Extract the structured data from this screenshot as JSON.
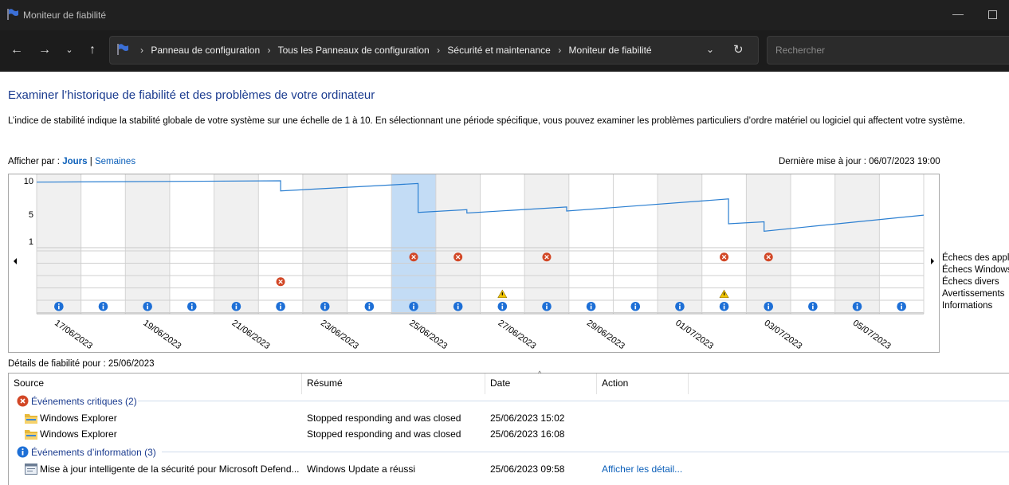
{
  "window": {
    "title": "Moniteur de fiabilité"
  },
  "address": {
    "crumbs": [
      "Panneau de configuration",
      "Tous les Panneaux de configuration",
      "Sécurité et maintenance",
      "Moniteur de fiabilité"
    ],
    "search_placeholder": "Rechercher"
  },
  "page": {
    "heading": "Examiner l’historique de fiabilité et des problèmes de votre ordinateur",
    "description": "L’indice de stabilité indique la stabilité globale de votre système sur une échelle de 1 à 10. En sélectionnant une période spécifique, vous pouvez examiner les problèmes particuliers d’ordre matériel ou logiciel qui affectent votre système.",
    "view_by_label": "Afficher par :",
    "view_days": "Jours",
    "view_sep": "|",
    "view_weeks": "Semaines",
    "last_update": "Dernière mise à jour : 06/07/2023 19:00"
  },
  "chart_data": {
    "type": "line",
    "y_ticks": [
      "10",
      "5",
      "1"
    ],
    "ylim": [
      1,
      10
    ],
    "columns": 20,
    "selected_column": 8,
    "weekend_columns": [
      0,
      2,
      4,
      6,
      9,
      11,
      14,
      16,
      18
    ],
    "x_labels": [
      "17/06/2023",
      "19/06/2023",
      "21/06/2023",
      "23/06/2023",
      "25/06/2023",
      "27/06/2023",
      "29/06/2023",
      "01/07/2023",
      "03/07/2023",
      "05/07/2023"
    ],
    "stability_points": [
      [
        0,
        9.8
      ],
      [
        5.5,
        10.0
      ],
      [
        5.5,
        8.5
      ],
      [
        8.6,
        9.6
      ],
      [
        8.6,
        5.3
      ],
      [
        9.7,
        5.7
      ],
      [
        9.7,
        5.2
      ],
      [
        11.95,
        6.1
      ],
      [
        11.95,
        5.5
      ],
      [
        15.6,
        7.3
      ],
      [
        15.6,
        3.6
      ],
      [
        16.4,
        3.9
      ],
      [
        16.4,
        2.5
      ],
      [
        20,
        4.9
      ]
    ],
    "legend": [
      "Échecs des applications",
      "Échecs Windows",
      "Échecs divers",
      "Avertissements",
      "Informations"
    ],
    "events": {
      "app_failures": [
        8,
        9,
        11,
        15,
        16
      ],
      "windows_failures": [],
      "misc_failures": [
        5
      ],
      "warnings": [
        10,
        15
      ],
      "information": [
        0,
        1,
        2,
        3,
        4,
        5,
        6,
        7,
        8,
        9,
        10,
        11,
        12,
        13,
        14,
        15,
        16,
        17,
        18,
        19
      ]
    }
  },
  "details": {
    "label": "Détails de fiabilité pour : 25/06/2023",
    "columns": [
      "Source",
      "Résumé",
      "Date",
      "Action"
    ],
    "groups": [
      {
        "title": "Événements critiques (2)",
        "icon": "critical-icon",
        "rows": [
          {
            "source": "Windows Explorer",
            "summary": "Stopped responding and was closed",
            "date": "25/06/2023 15:02",
            "action": "",
            "icon": "folder-icon"
          },
          {
            "source": "Windows Explorer",
            "summary": "Stopped responding and was closed",
            "date": "25/06/2023 16:08",
            "action": "",
            "icon": "folder-icon"
          }
        ]
      },
      {
        "title": "Événements d’information (3)",
        "icon": "info-icon",
        "rows": [
          {
            "source": "Mise à jour intelligente de la sécurité pour Microsoft Defend...",
            "summary": "Windows Update a réussi",
            "date": "25/06/2023 09:58",
            "action": "Afficher les détail...",
            "icon": "update-icon"
          }
        ]
      }
    ]
  }
}
